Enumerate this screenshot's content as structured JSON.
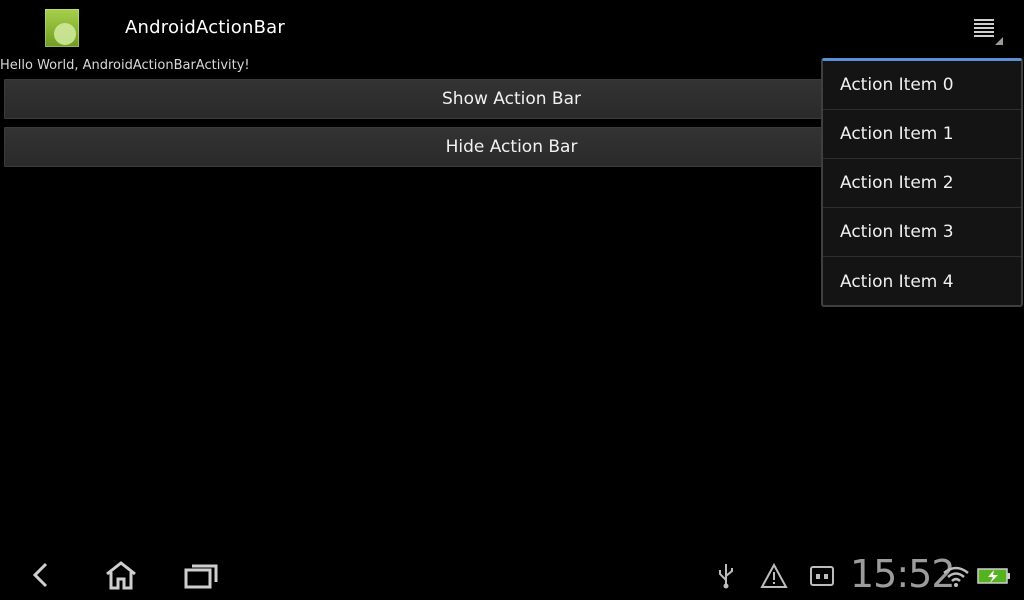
{
  "action_bar": {
    "title": "AndroidActionBar",
    "app_icon": "android-app-icon",
    "overflow_icon": "overflow-menu-icon"
  },
  "content": {
    "hello_text": "Hello World, AndroidActionBarActivity!",
    "show_button_label": "Show Action Bar",
    "hide_button_label": "Hide Action Bar"
  },
  "overflow_menu": {
    "items": [
      {
        "label": "Action Item 0"
      },
      {
        "label": "Action Item 1"
      },
      {
        "label": "Action Item 2"
      },
      {
        "label": "Action Item 3"
      },
      {
        "label": "Action Item 4"
      }
    ],
    "accent_color": "#5b8fd6"
  },
  "system_bar": {
    "time": "15:52",
    "nav_icons": [
      "back-icon",
      "home-icon",
      "recent-apps-icon"
    ],
    "status_icons": [
      "usb-icon",
      "warning-icon",
      "sd-card-icon",
      "wifi-icon",
      "battery-charging-icon"
    ]
  }
}
